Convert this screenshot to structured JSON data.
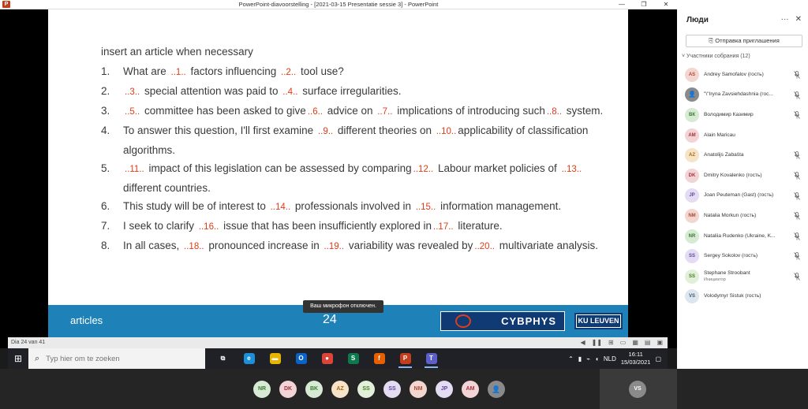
{
  "window": {
    "title": "PowerPoint-diavoorstelling - [2021-03-15 Presentatie sessie 3] - PowerPoint",
    "app_icon": "P",
    "controls": [
      "—",
      "❐",
      "✕"
    ]
  },
  "slide": {
    "intro": "insert an article when necessary",
    "items": [
      {
        "num": "1.",
        "parts": [
          "What are ",
          {
            "g": "..1.."
          },
          " factors influencing ",
          {
            "g": "..2.."
          },
          " tool use?"
        ]
      },
      {
        "num": "2.",
        "parts": [
          {
            "g": "..3.."
          },
          " special   attention was paid to ",
          {
            "g": "..4.."
          },
          " surface irregularities."
        ]
      },
      {
        "num": "3.",
        "parts": [
          {
            "g": "..5.."
          },
          " committee has been asked to give",
          {
            "g": "..6.."
          },
          " advice on ",
          {
            "g": "..7.."
          },
          " implications of introducing such",
          {
            "g": "..8.."
          },
          " system."
        ]
      },
      {
        "num": "4.",
        "parts": [
          "To answer this question, I'll first examine ",
          {
            "g": "..9.."
          },
          "  different theories on ",
          {
            "g": "..10.."
          },
          "applicability of classification algorithms."
        ]
      },
      {
        "num": "5.",
        "parts": [
          {
            "g": "..11.."
          },
          " impact of this legislation can be assessed by comparing",
          {
            "g": "..12.."
          },
          " Labour market policies of ",
          {
            "g": "..13.."
          },
          " different countries."
        ]
      },
      {
        "num": "6.",
        "parts": [
          "This study will be of interest to ",
          {
            "g": "..14.."
          },
          " professionals involved in ",
          {
            "g": "..15.."
          },
          "  information management."
        ]
      },
      {
        "num": "7.",
        "parts": [
          "I seek to clarify ",
          {
            "g": "..16.."
          },
          " issue that has been insufficiently explored in",
          {
            "g": "..17.."
          },
          " literature."
        ]
      },
      {
        "num": "8.",
        "parts": [
          "In all cases, ",
          {
            "g": "..18.."
          },
          " pronounced increase in ",
          {
            "g": "..19.."
          },
          " variability was revealed by",
          {
            "g": "..20.."
          },
          " multivariate analysis."
        ]
      }
    ],
    "footer_label": "articles",
    "page_number": "24",
    "cyb_logo": "CYBPHYS",
    "kul_logo": "KU LEUVEN",
    "gap_color": "#e03c1a",
    "footer_color": "#1e82b8"
  },
  "toast": "Ваш микрофон отключен.",
  "status_bar": {
    "slide_info": "Dia 24 van 41"
  },
  "taskbar": {
    "search_placeholder": "Typ hier om te zoeken",
    "apps": [
      {
        "name": "task-view",
        "glyph": "⧉",
        "color": "transparent"
      },
      {
        "name": "edge",
        "glyph": "e",
        "color": "#1b8fd9"
      },
      {
        "name": "file-explorer",
        "glyph": "▬",
        "color": "#e8b400"
      },
      {
        "name": "outlook",
        "glyph": "O",
        "color": "#0a64c8"
      },
      {
        "name": "chrome",
        "glyph": "●",
        "color": "#db4437"
      },
      {
        "name": "skype-business",
        "glyph": "S",
        "color": "#0d7a4e"
      },
      {
        "name": "firefox",
        "glyph": "f",
        "color": "#e66000"
      },
      {
        "name": "powerpoint",
        "glyph": "P",
        "color": "#c43e1c",
        "active": true
      },
      {
        "name": "teams",
        "glyph": "T",
        "color": "#5b5fc7",
        "active": true
      }
    ],
    "lang": "NLD",
    "time": "16:11",
    "date": "15/03/2021"
  },
  "panel": {
    "title": "Люди",
    "invite_label": "Отправка приглашения",
    "section": "Участники собрания (12)",
    "participants": [
      {
        "initials": "AS",
        "name": "Andrey Samofalov (гость)",
        "bg": "#f3d6d0",
        "fg": "#b04a35",
        "role": ""
      },
      {
        "initials": "",
        "name": "\"\\\"Iryna Zavsiehdashnia (гос...",
        "bg": "#8a8a8a",
        "fg": "#fff",
        "role": "",
        "generic": true
      },
      {
        "initials": "ВК",
        "name": "Володимир Казимир",
        "bg": "#d7ead4",
        "fg": "#3b7a33",
        "role": ""
      },
      {
        "initials": "AM",
        "name": "Alain Maricau",
        "bg": "#f2d3d6",
        "fg": "#a8323e",
        "role": ""
      },
      {
        "initials": "AZ",
        "name": "Anatolijs Zabašta",
        "bg": "#f6e3c8",
        "fg": "#a86a12",
        "role": ""
      },
      {
        "initials": "DK",
        "name": "Dmitry Kovalenko (гость)",
        "bg": "#f2d3d6",
        "fg": "#a8323e",
        "role": ""
      },
      {
        "initials": "JP",
        "name": "Joan Peuteman (Gast) (гость)",
        "bg": "#e3dcf2",
        "fg": "#5d4a9c",
        "role": ""
      },
      {
        "initials": "NM",
        "name": "Natalia Morkun (гость)",
        "bg": "#f3d6d0",
        "fg": "#b04a35",
        "role": ""
      },
      {
        "initials": "NR",
        "name": "Nataliia Rudenko (Ukraine, K...",
        "bg": "#d7ead4",
        "fg": "#3b7a33",
        "role": ""
      },
      {
        "initials": "SS",
        "name": "Sergey Sokolov (гость)",
        "bg": "#e3dcf2",
        "fg": "#5d4a9c",
        "role": ""
      },
      {
        "initials": "SS",
        "name": "Stephane Stroobant",
        "bg": "#e2efd9",
        "fg": "#4a7a2a",
        "role": "Инициатор"
      },
      {
        "initials": "VS",
        "name": "Volodymyr Sistuk (гость)",
        "bg": "#dde6ee",
        "fg": "#3d5a78",
        "role": ""
      }
    ],
    "muted": [
      true,
      true,
      true,
      false,
      true,
      true,
      true,
      true,
      true,
      true,
      true,
      false
    ]
  },
  "meeting_bar": {
    "avatars": [
      {
        "initials": "NR",
        "bg": "#d7ead4",
        "fg": "#3b7a33"
      },
      {
        "initials": "DK",
        "bg": "#f2d3d6",
        "fg": "#a8323e"
      },
      {
        "initials": "BK",
        "bg": "#d7ead4",
        "fg": "#3b7a33"
      },
      {
        "initials": "AZ",
        "bg": "#f6e3c8",
        "fg": "#a86a12"
      },
      {
        "initials": "SS",
        "bg": "#e2efd9",
        "fg": "#4a7a2a"
      },
      {
        "initials": "SS",
        "bg": "#e3dcf2",
        "fg": "#5d4a9c"
      },
      {
        "initials": "NM",
        "bg": "#f3d6d0",
        "fg": "#b04a35"
      },
      {
        "initials": "JP",
        "bg": "#e3dcf2",
        "fg": "#5d4a9c"
      },
      {
        "initials": "AM",
        "bg": "#f2d3d6",
        "fg": "#a8323e"
      },
      {
        "initials": "",
        "bg": "#8a8a8a",
        "fg": "#fff",
        "generic": true
      }
    ],
    "self_initials": "VS"
  }
}
